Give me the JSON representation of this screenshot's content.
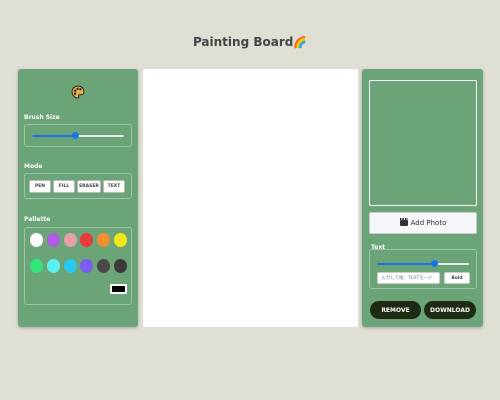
{
  "app": {
    "title": "Painting Board",
    "title_emoji": "🌈"
  },
  "left_panel": {
    "palette_icon": "artist-palette-icon",
    "brush_size": {
      "label": "Brush Size",
      "value_fraction": 0.47
    },
    "mode": {
      "label": "Mode",
      "buttons": [
        "PEN",
        "FILL",
        "ERASER",
        "TEXT"
      ]
    },
    "pallette": {
      "label": "Pallette",
      "colors": [
        "#ffffff",
        "#b05ce6",
        "#e8a0a8",
        "#e83a3a",
        "#f0902a",
        "#f5e61a",
        "#2ee67a",
        "#5cf0f0",
        "#2ac8f0",
        "#7a5cf0",
        "#4a4a4a",
        "#3a3a3a"
      ],
      "selected_color": "#000000"
    }
  },
  "right_panel": {
    "add_photo": {
      "icon": "clapperboard-icon",
      "label": "Add Photo"
    },
    "text_section": {
      "label": "Text",
      "size_fraction": 0.63,
      "input_placeholder": "入力して後、TEXTモード",
      "bold_label": "Bold"
    },
    "remove_label": "REMOVE",
    "download_label": "DOWNLOAD"
  },
  "colors": {
    "background": "#e0dfd4",
    "panel": "#6aa477",
    "accent": "#1a73e8",
    "dark_button": "#1e2a12"
  }
}
